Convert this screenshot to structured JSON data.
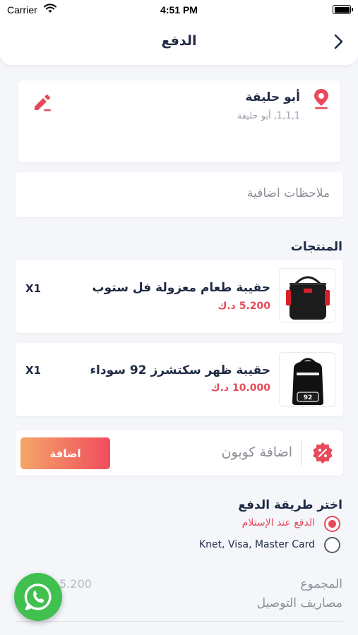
{
  "status_bar": {
    "carrier": "Carrier",
    "time": "4:51 PM"
  },
  "header": {
    "title": "الدفع"
  },
  "address": {
    "name": "أبو حليفة",
    "details": "1,1,1, أبو حليفة"
  },
  "notes": {
    "placeholder": "ملاحظات اضافية"
  },
  "products": {
    "section_title": "المنتجات",
    "items": [
      {
        "name": "حقيبة طعام معزولة فل ستوب",
        "price": "5.200 د.ك",
        "qty": "X1"
      },
      {
        "name": "حقيبة ظهر سكتشرز 92 سوداء",
        "price": "10.000 د.ك",
        "qty": "X1"
      }
    ]
  },
  "coupon": {
    "placeholder": "اضافة كوبون",
    "button_label": "اضافة"
  },
  "payment": {
    "section_title": "اختر طريقة الدفع",
    "options": [
      {
        "label": "الدفع عند الإستلام",
        "selected": true
      },
      {
        "label": "Knet, Visa,  Master Card",
        "selected": false
      }
    ]
  },
  "summary": {
    "total_label": "المجموع",
    "total_value": "5.200",
    "delivery_label": "مصاريف التوصيل"
  },
  "colors": {
    "accent": "#e84a5a",
    "whatsapp": "#3fc04f",
    "text": "#1f2a44"
  }
}
